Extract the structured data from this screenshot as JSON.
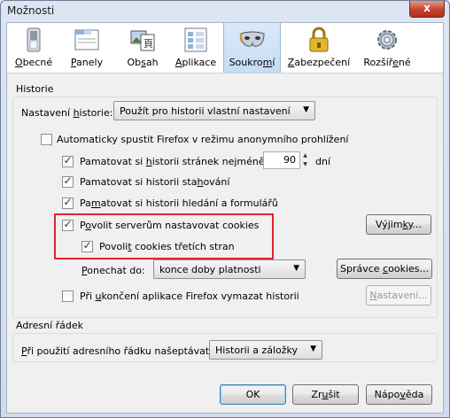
{
  "window": {
    "title": "Možnosti",
    "close": "x"
  },
  "tabs": [
    {
      "pre": "",
      "u": "O",
      "post": "becné",
      "icon": "general-switch-icon"
    },
    {
      "pre": "",
      "u": "P",
      "post": "anely",
      "icon": "tabs-icon"
    },
    {
      "pre": "Ob",
      "u": "s",
      "post": "ah",
      "icon": "content-icon"
    },
    {
      "pre": "",
      "u": "A",
      "post": "plikace",
      "icon": "applications-icon"
    },
    {
      "pre": "Soukro",
      "u": "m",
      "post": "í",
      "icon": "privacy-mask-icon"
    },
    {
      "pre": "",
      "u": "Z",
      "post": "abezpečení",
      "icon": "security-lock-icon"
    },
    {
      "pre": "Rozšíř",
      "u": "e",
      "post": "né",
      "icon": "advanced-gear-icon"
    }
  ],
  "history": {
    "group_label": "Historie",
    "setting_label_pre": "Nastavení ",
    "setting_label_u": "h",
    "setting_label_post": "istorie:",
    "setting_value": "Použít pro historii vlastní nastavení",
    "private_mode": {
      "label": "Automaticky spustit Firefox v režimu anonymního prohlížení",
      "checked": false
    },
    "remember_history_pre": "Pamatovat si ",
    "remember_history_u": "h",
    "remember_history_post": "istorii stránek nejméně",
    "remember_history_checked": true,
    "days_value": "90",
    "days_label": "dní",
    "downloads": {
      "pre": "Pamatovat si historii sta",
      "u": "h",
      "post": "ování",
      "checked": true
    },
    "forms": {
      "pre": "Pa",
      "u": "m",
      "post": "atovat si historii hledání a formulářů",
      "checked": true
    },
    "cookies": {
      "pre": "P",
      "u": "o",
      "post": "volit serverům nastavovat cookies",
      "checked": true
    },
    "third_party": {
      "pre": "Povoli",
      "u": "t",
      "post": " cookies třetích stran",
      "checked": true
    },
    "exceptions_button": {
      "pre": "Výjim",
      "u": "k",
      "post": "y..."
    },
    "keep_label_pre": "",
    "keep_label_u": "P",
    "keep_label_post": "onechat do:",
    "keep_value": "konce doby platnosti",
    "cookie_manager_button": {
      "pre": "Správce ",
      "u": "c",
      "post": "ookies..."
    },
    "clear_on_close": {
      "pre": "Při ",
      "u": "u",
      "post": "končení aplikace Firefox vymazat historii",
      "checked": false
    },
    "settings_button": {
      "pre": "",
      "u": "N",
      "post": "astavení..."
    }
  },
  "location_bar": {
    "group_label": "Adresní řádek",
    "suggest_label_pre": "",
    "suggest_label_u": "P",
    "suggest_label_post": "ři použití adresního řádku našeptávat:",
    "suggest_value": "Historii a záložky"
  },
  "footer": {
    "ok": "OK",
    "cancel": {
      "pre": "Zr",
      "u": "u",
      "post": "šit"
    },
    "help": {
      "pre": "Nápo",
      "u": "v",
      "post": "ěda"
    }
  }
}
